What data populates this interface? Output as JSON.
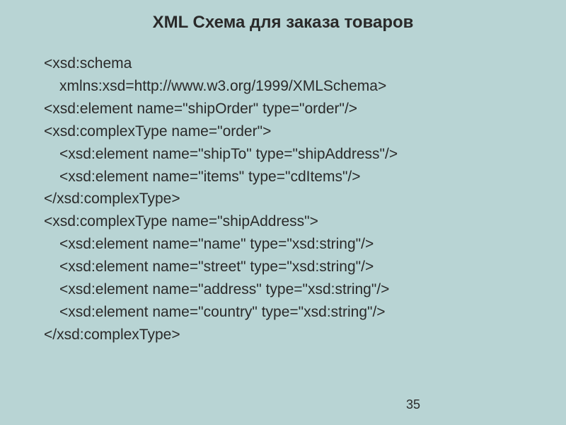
{
  "title": "XML Схема для заказа товаров",
  "lines": [
    {
      "indent": 0,
      "text": "<xsd:schema"
    },
    {
      "indent": 1,
      "text": "xmlns:xsd=http://www.w3.org/1999/XMLSchema>"
    },
    {
      "indent": 0,
      "text": "<xsd:element name=\"shipOrder\" type=\"order\"/>"
    },
    {
      "indent": 0,
      "text": "<xsd:complexType name=\"order\">"
    },
    {
      "indent": 1,
      "text": "<xsd:element name=\"shipTo\" type=\"shipAddress\"/>"
    },
    {
      "indent": 1,
      "text": "<xsd:element name=\"items\" type=\"cdItems\"/>"
    },
    {
      "indent": 0,
      "text": "</xsd:complexType>"
    },
    {
      "indent": 0,
      "text": "<xsd:complexType name=\"shipAddress\">"
    },
    {
      "indent": 1,
      "text": "<xsd:element name=\"name\" type=\"xsd:string\"/>"
    },
    {
      "indent": 1,
      "text": "<xsd:element name=\"street\" type=\"xsd:string\"/>"
    },
    {
      "indent": 1,
      "text": "<xsd:element name=\"address\" type=\"xsd:string\"/>"
    },
    {
      "indent": 1,
      "text": "<xsd:element name=\"country\" type=\"xsd:string\"/>"
    },
    {
      "indent": 0,
      "text": "</xsd:complexType>"
    }
  ],
  "pageNumber": "35"
}
